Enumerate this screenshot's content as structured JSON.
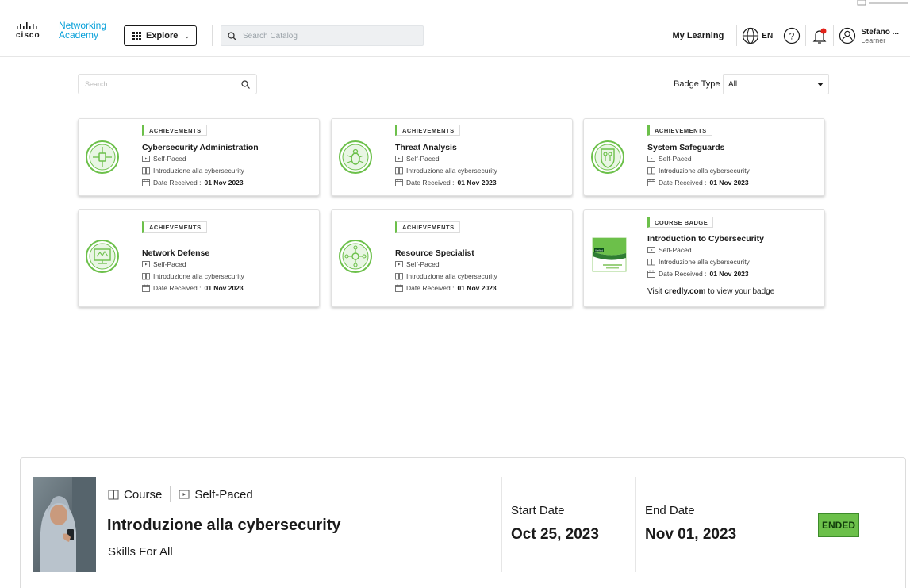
{
  "header": {
    "logo": {
      "brand_line1": "Networking",
      "brand_line2": "Academy",
      "cisco_text": "cisco"
    },
    "explore_label": "Explore",
    "search_placeholder": "Search Catalog",
    "my_learning_label": "My Learning",
    "language_label": "EN",
    "user": {
      "name": "Stefano ...",
      "role": "Learner"
    },
    "brand_color": "#049fd9",
    "notification_dot_color": "#e2231a"
  },
  "filters": {
    "search_placeholder": "Search...",
    "badge_type_label": "Badge Type",
    "badge_type_value": "All"
  },
  "accent_green": "#6cc04a",
  "badges": [
    {
      "tag": "ACHIEVEMENTS",
      "title": "Cybersecurity Administration",
      "delivery": "Self-Paced",
      "course": "Introduzione alla cybersecurity",
      "date_label": "Date Received :",
      "date": "01 Nov 2023",
      "icon": "network-shield-icon"
    },
    {
      "tag": "ACHIEVEMENTS",
      "title": "Threat Analysis",
      "delivery": "Self-Paced",
      "course": "Introduzione alla cybersecurity",
      "date_label": "Date Received :",
      "date": "01 Nov 2023",
      "icon": "bug-icon"
    },
    {
      "tag": "ACHIEVEMENTS",
      "title": "System Safeguards",
      "delivery": "Self-Paced",
      "course": "Introduzione alla cybersecurity",
      "date_label": "Date Received :",
      "date": "01 Nov 2023",
      "icon": "shield-keys-icon"
    },
    {
      "tag": "ACHIEVEMENTS",
      "title": "Network Defense",
      "delivery": "Self-Paced",
      "course": "Introduzione alla cybersecurity",
      "date_label": "Date Received :",
      "date": "01 Nov 2023",
      "icon": "monitor-network-icon"
    },
    {
      "tag": "ACHIEVEMENTS",
      "title": "Resource Specialist",
      "delivery": "Self-Paced",
      "course": "Introduzione alla cybersecurity",
      "date_label": "Date Received :",
      "date": "01 Nov 2023",
      "icon": "hub-nodes-icon"
    },
    {
      "tag": "COURSE BADGE",
      "title": "Introduction to Cybersecurity",
      "delivery": "Self-Paced",
      "course": "Introduzione alla cybersecurity",
      "date_label": "Date Received :",
      "date": "01 Nov 2023",
      "icon": "credly-badge-icon",
      "visit_prefix": "Visit",
      "visit_link": "credly.com",
      "visit_suffix": "to view your badge",
      "emblem_text": "Verified"
    }
  ],
  "course": {
    "type_label": "Course",
    "delivery_label": "Self-Paced",
    "title": "Introduzione alla cybersecurity",
    "provider": "Skills For All",
    "start_label": "Start Date",
    "start_value": "Oct 25, 2023",
    "end_label": "End Date",
    "end_value": "Nov 01, 2023",
    "status": "ENDED"
  }
}
